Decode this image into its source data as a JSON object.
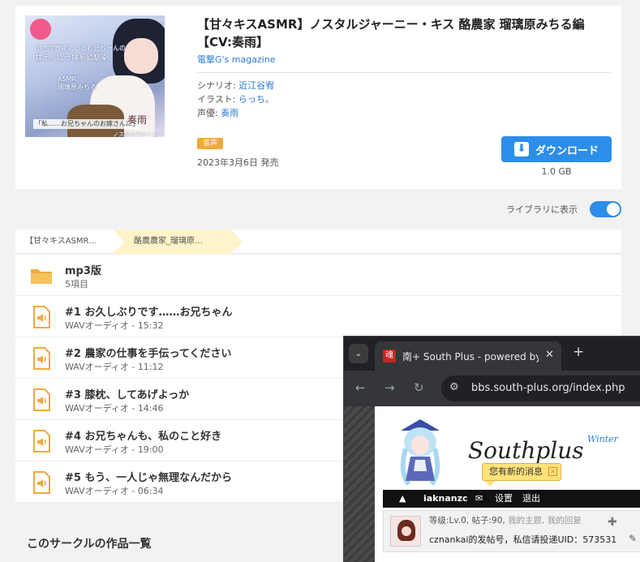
{
  "product": {
    "title": "【甘々キスASMR】ノスタルジャーニー・キス 酪農家 瑠璃原みちる編【CV:奏雨】",
    "circle": "電撃G's magazine",
    "credits": [
      {
        "label": "シナリオ:",
        "value": "近江谷宥"
      },
      {
        "label": "イラスト:",
        "value": "らっち。"
      },
      {
        "label": "声優:",
        "value": "奏雨"
      }
    ],
    "tag": "音声",
    "release_date": "2023年3月6日 発売",
    "download_label": "ダウンロード",
    "size": "1.0 GB",
    "cover_text": {
      "t1": "小さな牧場にいるお兄ちゃんの",
      "t2": "甘えんぼう妹系幼馴染",
      "t3": "ASMR",
      "t4": "瑠璃原みちる",
      "t5": "「私……お兄ちゃんのお嫁さんに」",
      "t6": "奏雨",
      "t7": "ノスタルジャーニー・キス"
    }
  },
  "library": {
    "label": "ライブラリに表示",
    "enabled": true
  },
  "breadcrumb": [
    "【甘々キスASMR…",
    "酪農農家_瑠璃原…"
  ],
  "files": [
    {
      "type": "folder",
      "name": "mp3版",
      "meta": "5項目"
    },
    {
      "type": "audio",
      "name": "#1 お久しぶりです……お兄ちゃん",
      "meta": "WAVオーディオ - 15:32"
    },
    {
      "type": "audio",
      "name": "#2 農家の仕事を手伝ってください",
      "meta": "WAVオーディオ - 11:12"
    },
    {
      "type": "audio",
      "name": "#3 膝枕、してあげよっか",
      "meta": "WAVオーディオ - 14:46"
    },
    {
      "type": "audio",
      "name": "#4 お兄ちゃんも、私のこと好き",
      "meta": "WAVオーディオ - 19:00"
    },
    {
      "type": "audio",
      "name": "#5 もう、一人じゃ無理なんだから",
      "meta": "WAVオーディオ - 06:34"
    }
  ],
  "section_title": "このサークルの作品一覧",
  "browser": {
    "tab_title": "南+ South Plus - powered by",
    "tab_favicon": "魂",
    "url": "bbs.south-plus.org/index.php",
    "site": {
      "logo": "Southplus",
      "logo_sub": "Winter",
      "notice": "您有新的消息",
      "nav": {
        "username": "iaknanzc",
        "settings": "设置",
        "logout": "退出"
      },
      "info_level": "等级:Lv.0, 帖子:90,",
      "info_links": "我的主题, 我的回复",
      "info_line2": "cznankai的发帖号，私信请投递UID：573531"
    }
  },
  "colors": {
    "accent": "#2c8ee8",
    "tag": "#f0a93c",
    "icon": "#f0a93c",
    "link": "#2a7bd6"
  }
}
